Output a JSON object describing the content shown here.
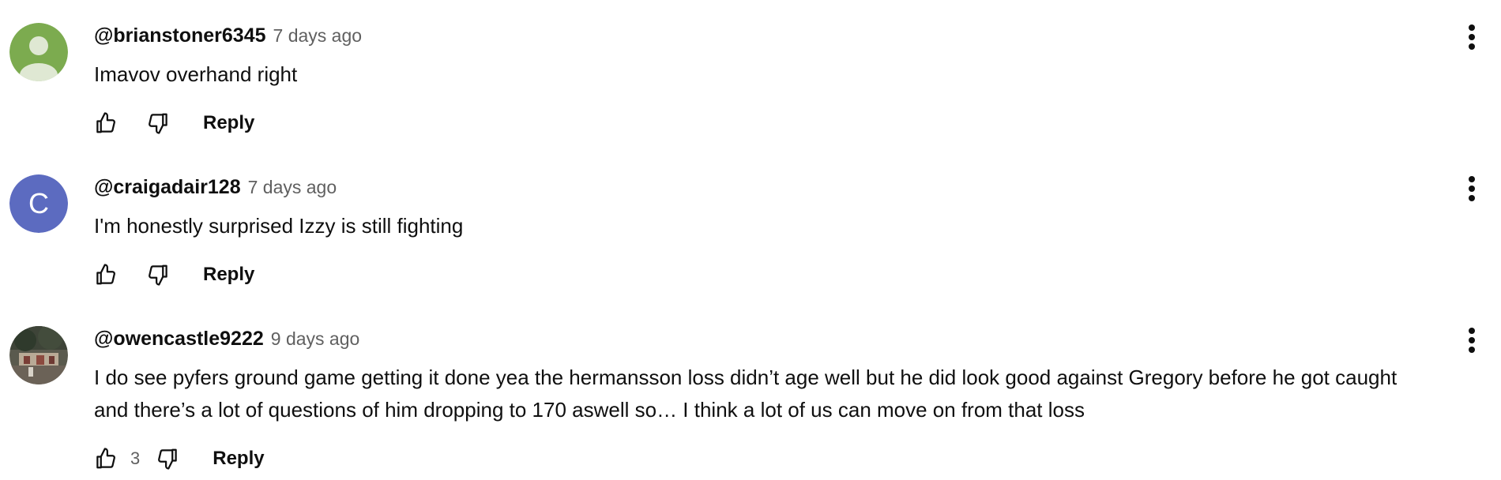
{
  "comments": [
    {
      "author": "@brianstoner6345",
      "time": "7 days ago",
      "text": "Imavov overhand right",
      "avatar": {
        "type": "default-person",
        "color": "#7cab4f"
      },
      "likes": "",
      "reply_label": "Reply"
    },
    {
      "author": "@craigadair128",
      "time": "7 days ago",
      "text": "I'm honestly surprised Izzy is still fighting",
      "avatar": {
        "type": "letter",
        "letter": "C",
        "color": "#5c6bc0"
      },
      "likes": "",
      "reply_label": "Reply"
    },
    {
      "author": "@owencastle9222",
      "time": "9 days ago",
      "text": "I do see pyfers ground game getting it done yea the hermansson loss didn’t age well but he did look good against Gregory before he got caught and there’s a lot of questions of him dropping to 170 aswell so… I think a lot of us can move on from that loss",
      "avatar": {
        "type": "photo"
      },
      "likes": "3",
      "reply_label": "Reply"
    }
  ],
  "icons": {
    "like": "thumbs-up-icon",
    "dislike": "thumbs-down-icon",
    "menu": "more-vert-icon"
  }
}
